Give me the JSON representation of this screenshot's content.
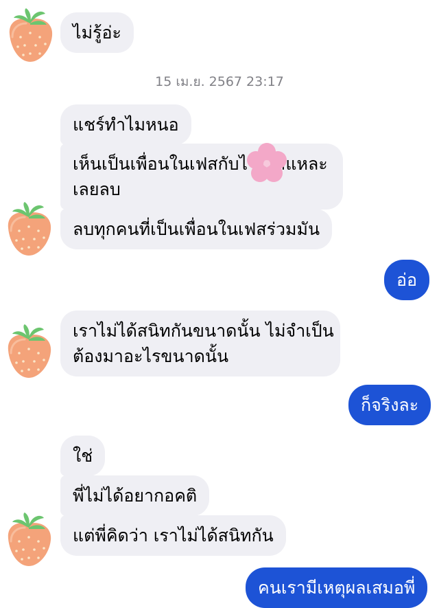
{
  "timestamp": "15 เม.ย. 2567 23:17",
  "messages": [
    {
      "side": "in",
      "text": "ไม่รู้อ่ะ"
    },
    {
      "side": "in",
      "text": "แชร์ทำไมหนอ"
    },
    {
      "side": "in",
      "line1": "เห็นเป็นเพื่อนในเฟสกับไ",
      "line1_tail": "สแหละ",
      "line2": "เลยลบ"
    },
    {
      "side": "in",
      "text": "ลบทุกคนที่เป็นเพื่อนในเฟสร่วมมัน"
    },
    {
      "side": "out",
      "text": "อ่อ"
    },
    {
      "side": "in",
      "line1": "เราไม่ได้สนิทกันขนาดนั้น ไม่จำเป็น",
      "line2": "ต้องมาอะไรขนาดนั้น"
    },
    {
      "side": "out",
      "text": "ก็จริงละ"
    },
    {
      "side": "in",
      "text": "ใช่"
    },
    {
      "side": "in",
      "text": "พี่ไม่ได้อยากอคติ"
    },
    {
      "side": "in",
      "text": "แต่พี่คิดว่า เราไม่ได้สนิทกัน"
    },
    {
      "side": "out",
      "text": "คนเรามีเหตุผลเสมอพี่"
    }
  ],
  "avatar_icon": "strawberry-icon",
  "sticker_icon": "flower-sticker-icon",
  "colors": {
    "incoming_bubble": "#efeff4",
    "outgoing_bubble": "#1d53d6",
    "timestamp_text": "#808086",
    "strawberry": "#f4a37a",
    "leaf": "#6cc56f",
    "flower": "#f3a8c8"
  }
}
